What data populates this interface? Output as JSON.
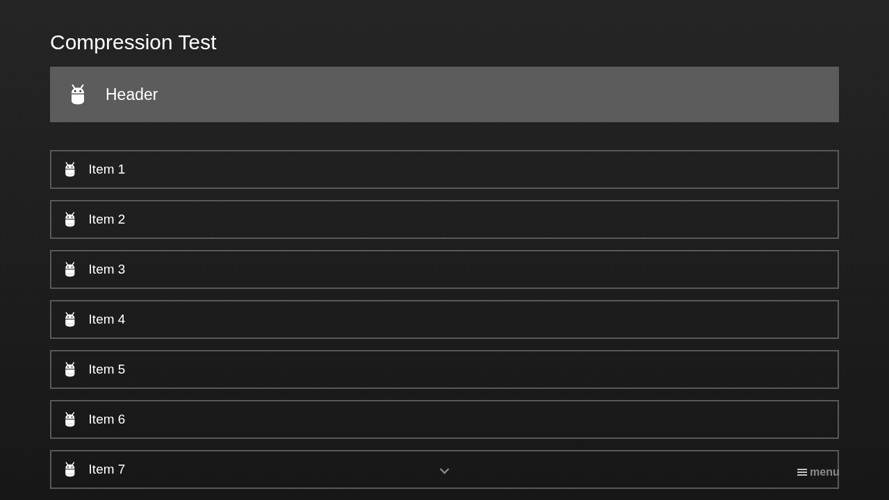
{
  "title": "Compression Test",
  "header": {
    "label": "Header"
  },
  "items": [
    {
      "label": "Item 1"
    },
    {
      "label": "Item 2"
    },
    {
      "label": "Item 3"
    },
    {
      "label": "Item 4"
    },
    {
      "label": "Item 5"
    },
    {
      "label": "Item 6"
    },
    {
      "label": "Item 7"
    }
  ],
  "menu_hint": {
    "label": "menu"
  }
}
